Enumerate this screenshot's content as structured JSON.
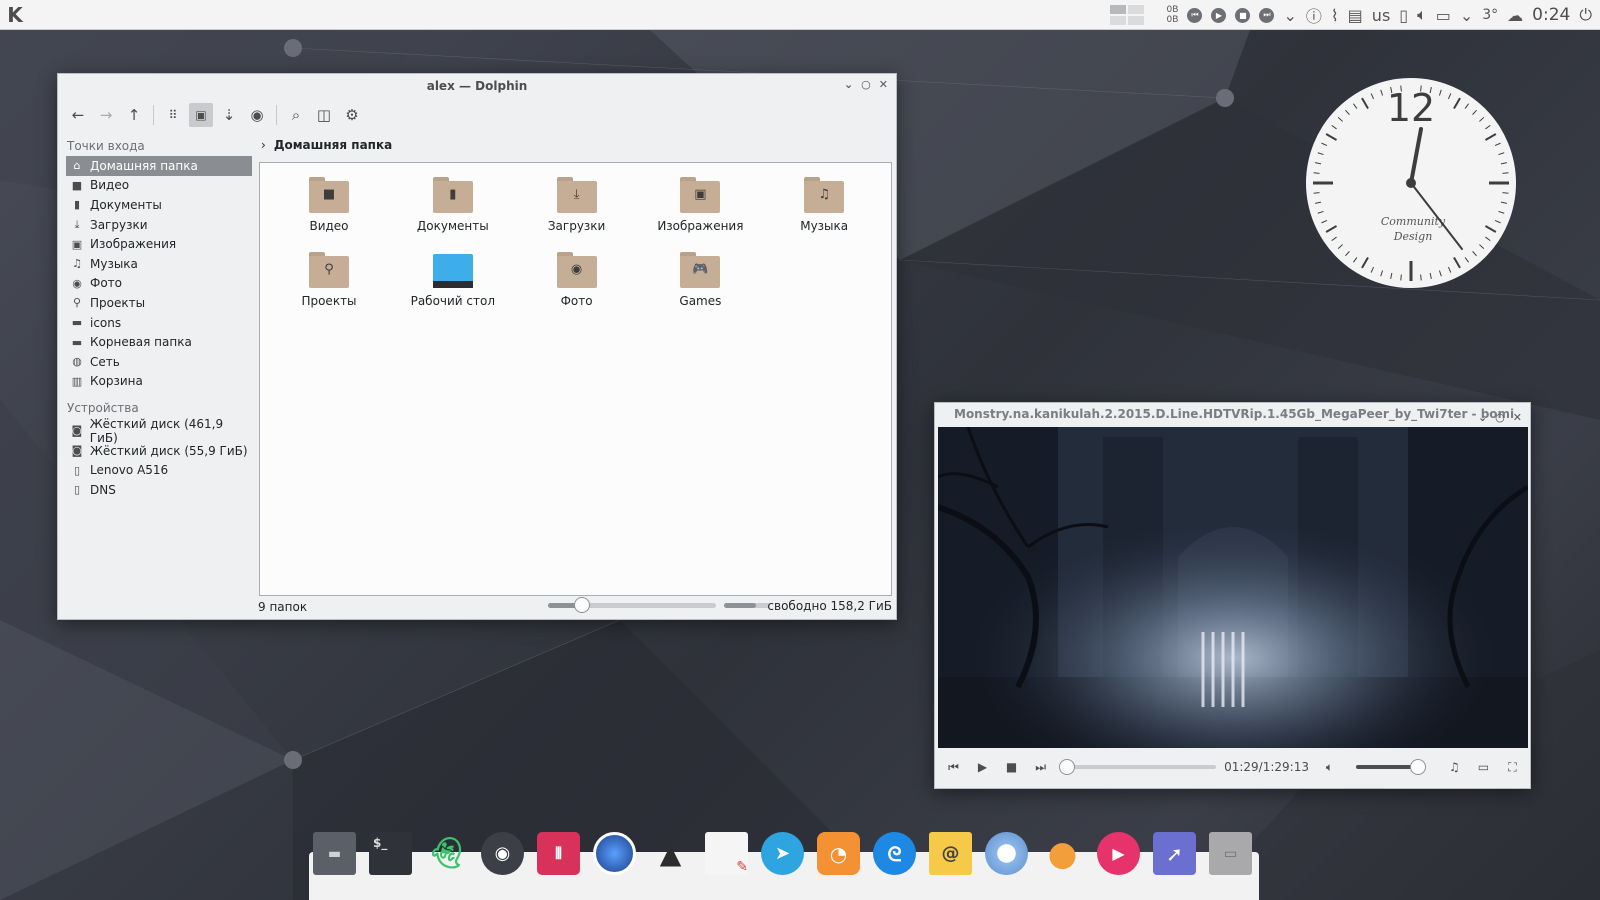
{
  "panel": {
    "k_menu": "K",
    "net_up": "0B",
    "net_down": "0B",
    "keyboard_layout": "us",
    "weather_temp": "3°",
    "clock_time": "0:24"
  },
  "dolphin": {
    "title": "alex — Dolphin",
    "places_header": "Точки входа",
    "places": [
      {
        "label": "Домашняя папка",
        "icon": "home-icon"
      },
      {
        "label": "Видео",
        "icon": "video-icon"
      },
      {
        "label": "Документы",
        "icon": "document-icon"
      },
      {
        "label": "Загрузки",
        "icon": "download-icon"
      },
      {
        "label": "Изображения",
        "icon": "image-icon"
      },
      {
        "label": "Музыка",
        "icon": "music-icon"
      },
      {
        "label": "Фото",
        "icon": "camera-icon"
      },
      {
        "label": "Проекты",
        "icon": "projects-icon"
      },
      {
        "label": "icons",
        "icon": "folder-icon"
      },
      {
        "label": "Корневая папка",
        "icon": "folder-icon"
      },
      {
        "label": "Сеть",
        "icon": "network-icon"
      },
      {
        "label": "Корзина",
        "icon": "trash-icon"
      }
    ],
    "devices_header": "Устройства",
    "devices": [
      {
        "label": "Жёсткий диск (461,9 ГиБ)",
        "icon": "harddisk-icon"
      },
      {
        "label": "Жёсткий диск (55,9 ГиБ)",
        "icon": "harddisk-icon"
      },
      {
        "label": "Lenovo A516",
        "icon": "phone-icon"
      },
      {
        "label": "DNS",
        "icon": "phone-icon"
      }
    ],
    "breadcrumb": "Домашняя папка",
    "files": [
      {
        "label": "Видео",
        "glyph": "■"
      },
      {
        "label": "Документы",
        "glyph": "▮"
      },
      {
        "label": "Загрузки",
        "glyph": "⤓"
      },
      {
        "label": "Изображения",
        "glyph": "▣"
      },
      {
        "label": "Музыка",
        "glyph": "♫"
      },
      {
        "label": "Проекты",
        "glyph": "⚲"
      },
      {
        "label": "Рабочий стол",
        "glyph": ""
      },
      {
        "label": "Фото",
        "glyph": "◉"
      },
      {
        "label": "Games",
        "glyph": "🎮"
      }
    ],
    "status_count": "9 папок",
    "zoom_level": 0.2,
    "disk_used_fraction": 0.7,
    "status_free": "свободно 158,2 ГиБ"
  },
  "clock_widget": {
    "twelve": "12",
    "brand_line1": "Community",
    "brand_line2": "Design"
  },
  "player": {
    "title": "Monstry.na.kanikulah.2.2015.D.Line.HDTVRip.1.45Gb_MegaPeer_by_Twi7ter - bomi",
    "time": "01:29/1:29:13"
  },
  "colors": {
    "accent": "#3daee9",
    "selection": "#8a8d91",
    "folder": "#c5ae95"
  }
}
